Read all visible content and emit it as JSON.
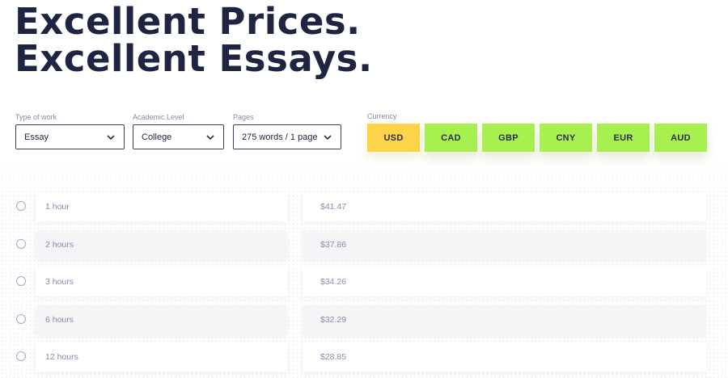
{
  "headline": {
    "line1": "Excellent Prices.",
    "line2": "Excellent Essays."
  },
  "form": {
    "type_of_work": {
      "label": "Type of work",
      "value": "Essay"
    },
    "academic_level": {
      "label": "Academic Level",
      "value": "College"
    },
    "pages": {
      "label": "Pages",
      "value": "275 words / 1 page"
    }
  },
  "currency": {
    "label": "Currency",
    "options": [
      "USD",
      "CAD",
      "GBP",
      "CNY",
      "EUR",
      "AUD"
    ],
    "selected": "USD",
    "colors": {
      "active": "#fdd34a",
      "inactive": "#a7f050"
    }
  },
  "deadlines": [
    {
      "time": "1 hour",
      "price": "$41.47"
    },
    {
      "time": "2 hours",
      "price": "$37.86"
    },
    {
      "time": "3 hours",
      "price": "$34.26"
    },
    {
      "time": "6 hours",
      "price": "$32.29"
    },
    {
      "time": "12 hours",
      "price": "$28.85"
    }
  ]
}
